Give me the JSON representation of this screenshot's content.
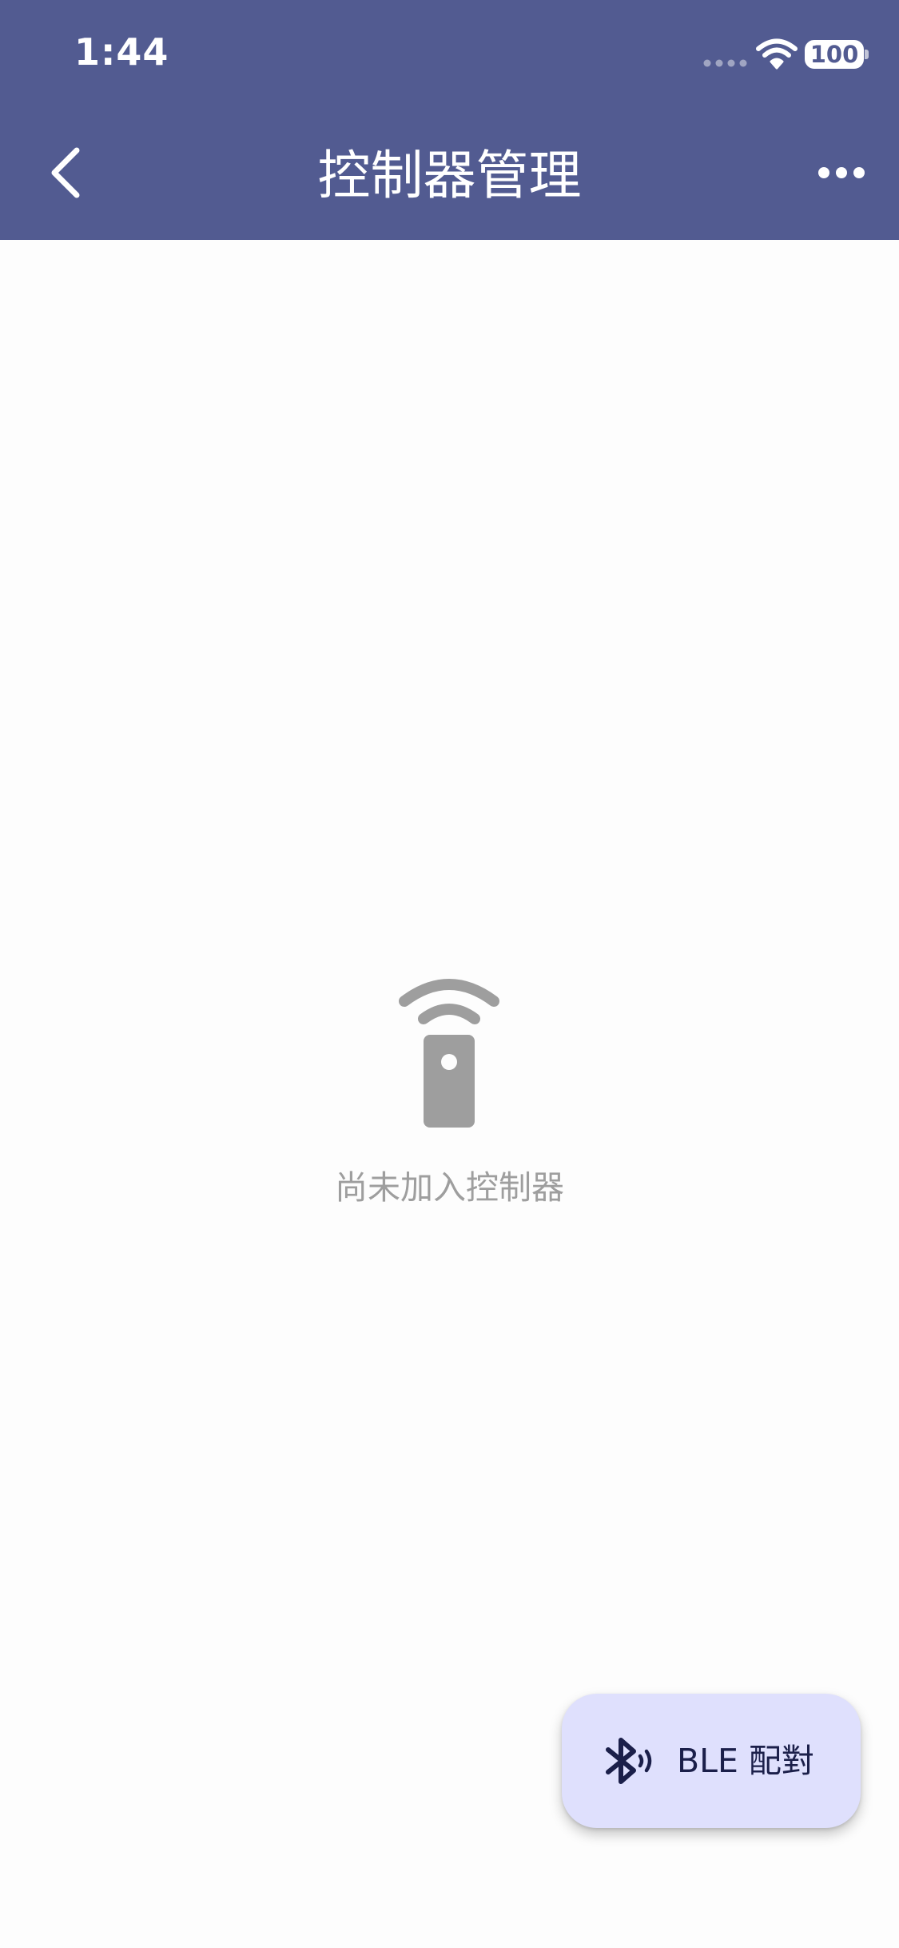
{
  "status_bar": {
    "time": "1:44",
    "battery": "100"
  },
  "header": {
    "title": "控制器管理",
    "back_icon": "chevron-left-icon",
    "more_icon": "more-horizontal-icon"
  },
  "empty_state": {
    "icon": "remote-controller-icon",
    "message": "尚未加入控制器"
  },
  "fab": {
    "label": "BLE 配對",
    "icon": "bluetooth-searching-icon"
  },
  "colors": {
    "header_bg": "#525b91",
    "fab_bg": "#dfe0fd",
    "empty_gray": "#9e9e9e"
  }
}
